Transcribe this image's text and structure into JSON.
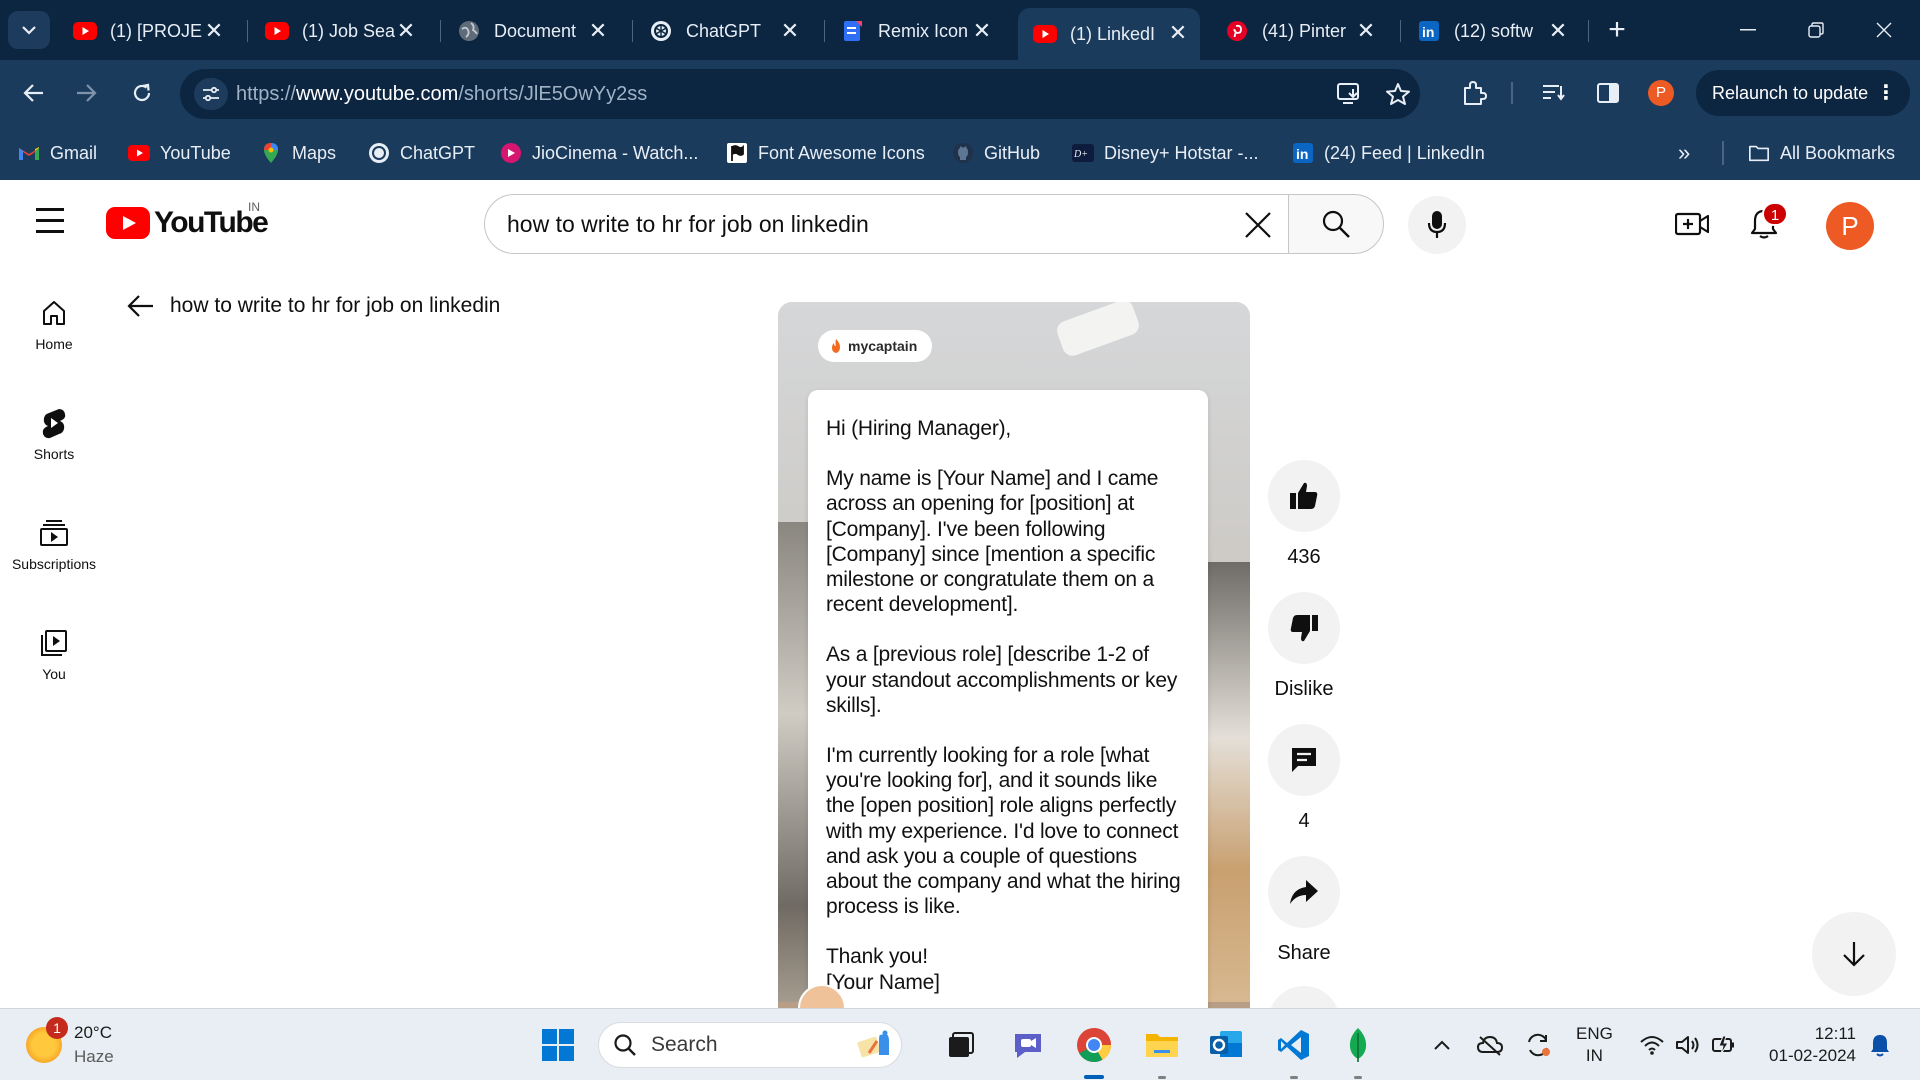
{
  "browser": {
    "tabs": [
      {
        "title": "(1) [PROJE",
        "icon": "youtube-icon",
        "active": false
      },
      {
        "title": "(1) Job Sea",
        "icon": "youtube-icon",
        "active": false
      },
      {
        "title": "Document",
        "icon": "globe-icon",
        "active": false
      },
      {
        "title": "ChatGPT",
        "icon": "chatgpt-icon",
        "active": false
      },
      {
        "title": "Remix Icon",
        "icon": "remix-icon",
        "active": false
      },
      {
        "title": "(1) LinkedI",
        "icon": "youtube-icon",
        "active": true
      },
      {
        "title": "(41) Pinter",
        "icon": "pinterest-icon",
        "active": false
      },
      {
        "title": "(12) softw",
        "icon": "linkedin-icon",
        "active": false
      }
    ],
    "url_prefix": "https://",
    "url_host": "www.youtube.com",
    "url_path": "/shorts/JlE5OwYy2ss",
    "profile_initial": "P",
    "relaunch_label": "Relaunch to update",
    "bookmarks": [
      {
        "label": "Gmail",
        "icon": "gmail-icon"
      },
      {
        "label": "YouTube",
        "icon": "youtube-icon"
      },
      {
        "label": "Maps",
        "icon": "maps-icon"
      },
      {
        "label": "ChatGPT",
        "icon": "chatgpt-icon"
      },
      {
        "label": "JioCinema - Watch...",
        "icon": "jiocinema-icon"
      },
      {
        "label": "Font Awesome Icons",
        "icon": "flag-icon"
      },
      {
        "label": "GitHub",
        "icon": "github-icon"
      },
      {
        "label": "Disney+ Hotstar -...",
        "icon": "hotstar-icon"
      },
      {
        "label": "(24) Feed | LinkedIn",
        "icon": "linkedin-icon"
      }
    ],
    "all_bookmarks_label": "All Bookmarks",
    "colors": {
      "chrome_dark": "#0c2540",
      "chrome_mid": "#1b3b5d"
    }
  },
  "youtube": {
    "logo_text": "YouTube",
    "country_code": "IN",
    "search": {
      "value": "how to write to hr for job on linkedin",
      "placeholder": "Search"
    },
    "notification_count": "1",
    "avatar_initial": "P",
    "guide": [
      {
        "label": "Home",
        "icon": "home-icon"
      },
      {
        "label": "Shorts",
        "icon": "shorts-icon"
      },
      {
        "label": "Subscriptions",
        "icon": "subscriptions-icon"
      },
      {
        "label": "You",
        "icon": "you-library-icon"
      }
    ],
    "query_title": "how to write to hr for job on linkedin",
    "short": {
      "brand": "mycaptain",
      "letter": [
        "Hi (Hiring Manager),",
        "My name is [Your Name] and I came across an opening for [position] at [Company]. I've been following [Company] since [mention a specific milestone or congratulate them on a recent development].",
        "As a [previous role] [describe 1-2 of your standout accomplishments or key skills].",
        "I'm currently looking for a role [what you're looking for], and it sounds like the [open position] role aligns perfectly with my experience. I'd love to connect and ask you a couple of questions about the company and what the hiring process is like.",
        "Thank you!",
        "[Your Name]"
      ]
    },
    "actions": {
      "like_count": "436",
      "dislike_label": "Dislike",
      "comment_count": "4",
      "share_label": "Share"
    },
    "colors": {
      "brand_red": "#ff0000",
      "avatar": "#ee5a24"
    }
  },
  "taskbar": {
    "weather_temp": "20°C",
    "weather_desc": "Haze",
    "weather_badge": "1",
    "search_label": "Search",
    "lang_line1": "ENG",
    "lang_line2": "IN",
    "time": "12:11",
    "date": "01-02-2024"
  }
}
